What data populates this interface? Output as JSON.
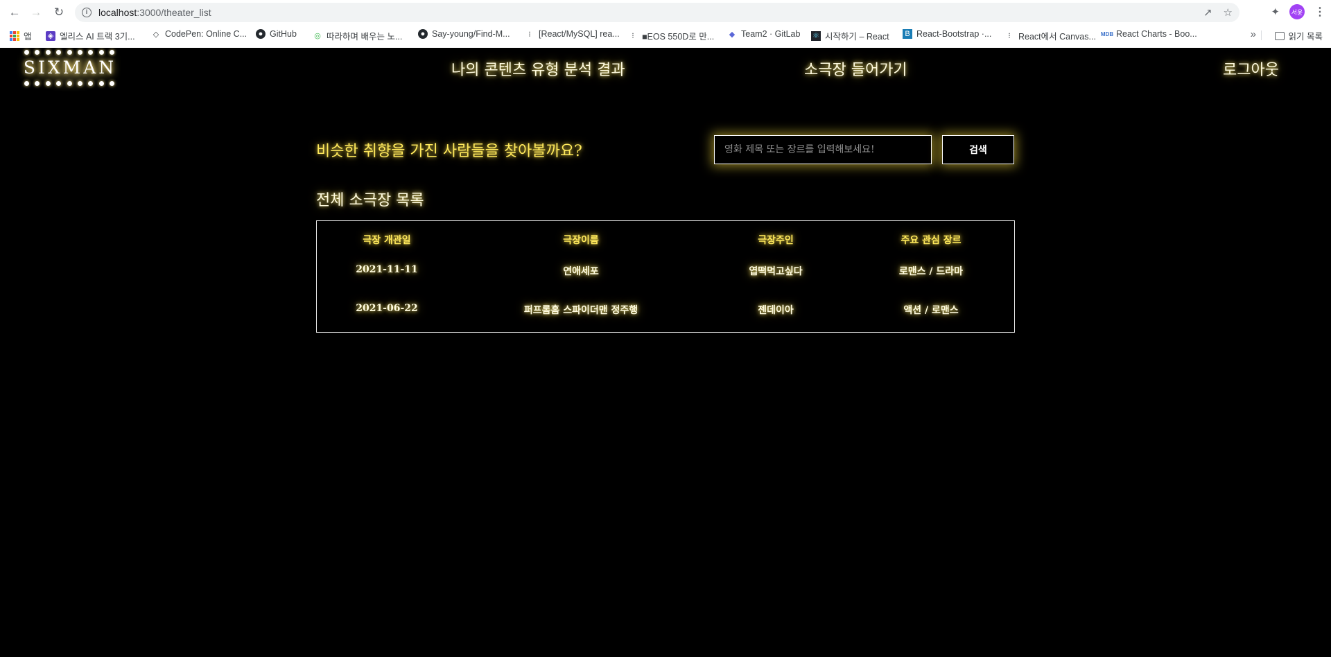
{
  "browser": {
    "url_host": "localhost",
    "url_path": ":3000/theater_list",
    "avatar_text": "서윤",
    "bookmarks": [
      {
        "label": "앱",
        "icon": "apps-grid-icon"
      },
      {
        "label": "엘리스 AI 트랙 3기...",
        "icon": "elice-icon"
      },
      {
        "label": "CodePen: Online C...",
        "icon": "codepen-icon"
      },
      {
        "label": "GitHub",
        "icon": "github-icon"
      },
      {
        "label": "따라하며 배우는 노...",
        "icon": "course-icon"
      },
      {
        "label": "Say-young/Find-M...",
        "icon": "github-icon"
      },
      {
        "label": "[React/MySQL] rea...",
        "icon": "velog-icon"
      },
      {
        "label": "■EOS 550D로 만...",
        "icon": "velog-icon"
      },
      {
        "label": "Team2 · GitLab",
        "icon": "gitlab-icon"
      },
      {
        "label": "시작하기 – React",
        "icon": "react-icon"
      },
      {
        "label": "React-Bootstrap ·...",
        "icon": "bootstrap-icon"
      },
      {
        "label": "React에서 Canvas...",
        "icon": "velog-icon"
      },
      {
        "label": "React Charts - Boo...",
        "icon": "mdb-icon"
      }
    ],
    "more_label": "»",
    "reading_list": "읽기 목록"
  },
  "header": {
    "logo": "SIXMAN",
    "nav": {
      "analysis": "나의 콘텐츠 유형 분석 결과",
      "theater": "소극장 들어가기",
      "logout": "로그아웃"
    }
  },
  "search": {
    "question": "비슷한 취향을 가진 사람들을 찾아볼까요?",
    "placeholder": "영화 제목 또는 장르를 입력해보세요!",
    "button": "검색"
  },
  "list": {
    "title": "전체 소극장 목록",
    "columns": [
      "극장 개관일",
      "극장이름",
      "극장주인",
      "주요 관심 장르"
    ],
    "rows": [
      [
        "2021-11-11",
        "연애세포",
        "엽떡먹고싶다",
        "로맨스 / 드라마"
      ],
      [
        "2021-06-22",
        "퍼프롬홈 스파이더맨 정주행",
        "젠데이아",
        "액션 / 로맨스"
      ]
    ]
  },
  "colors": {
    "background": "#000000",
    "glow": "#ffe95c",
    "text": "#fffbe0"
  }
}
